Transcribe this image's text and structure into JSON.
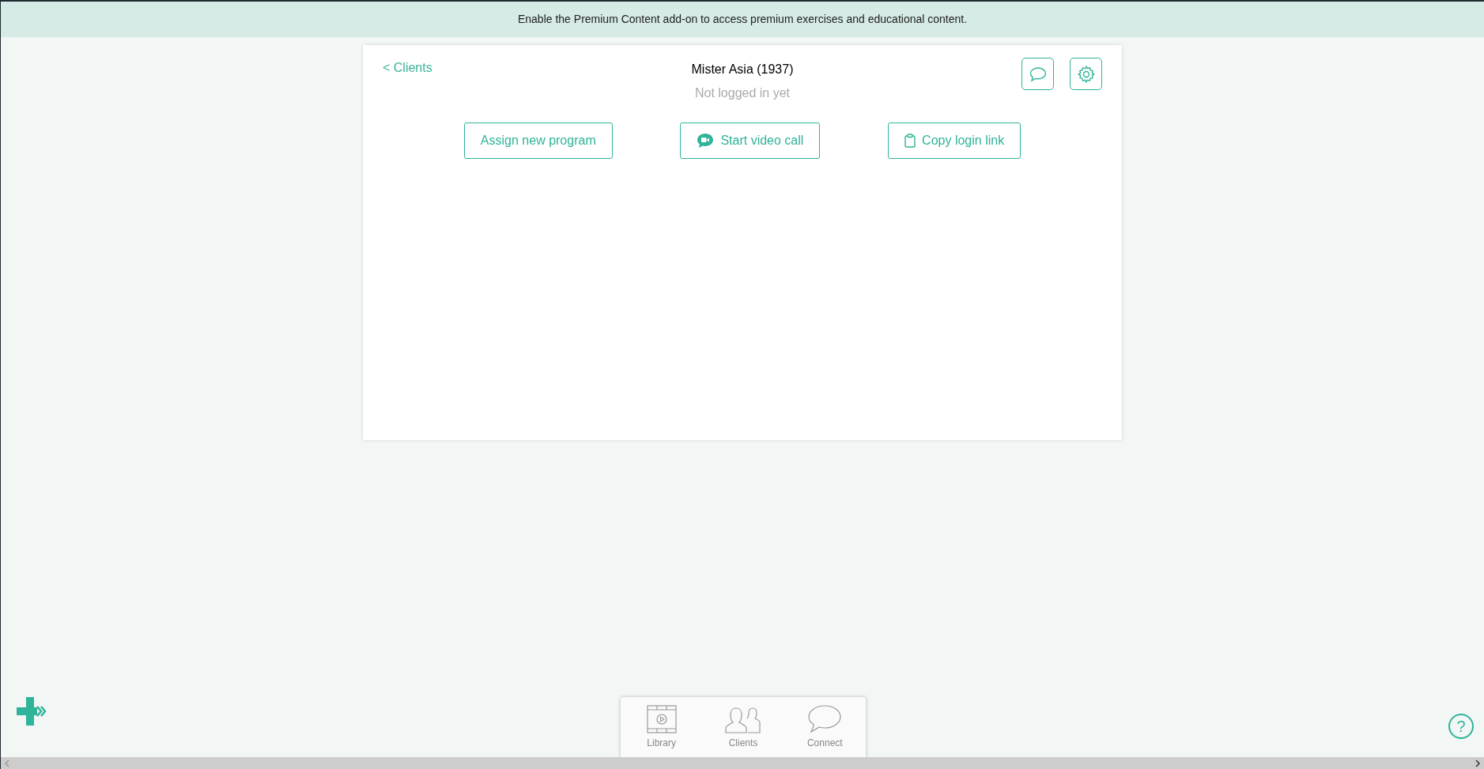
{
  "banner": {
    "text": "Enable the Premium Content add-on to access premium exercises and educational content."
  },
  "client": {
    "back_link": "< Clients",
    "name": "Mister Asia (1937)",
    "status": "Not logged in yet"
  },
  "header_buttons": [
    {
      "kind": "chat"
    },
    {
      "kind": "settings"
    }
  ],
  "actions": [
    {
      "label": "Assign new program",
      "kind": "plain"
    },
    {
      "label": "Start video call",
      "kind": "video"
    },
    {
      "label": "Copy login link",
      "kind": "clipboard"
    }
  ],
  "bottom_nav": [
    {
      "label": "Library",
      "kind": "library"
    },
    {
      "label": "Clients",
      "kind": "clients"
    },
    {
      "label": "Connect",
      "kind": "connect"
    }
  ],
  "help": {
    "label": "?"
  }
}
